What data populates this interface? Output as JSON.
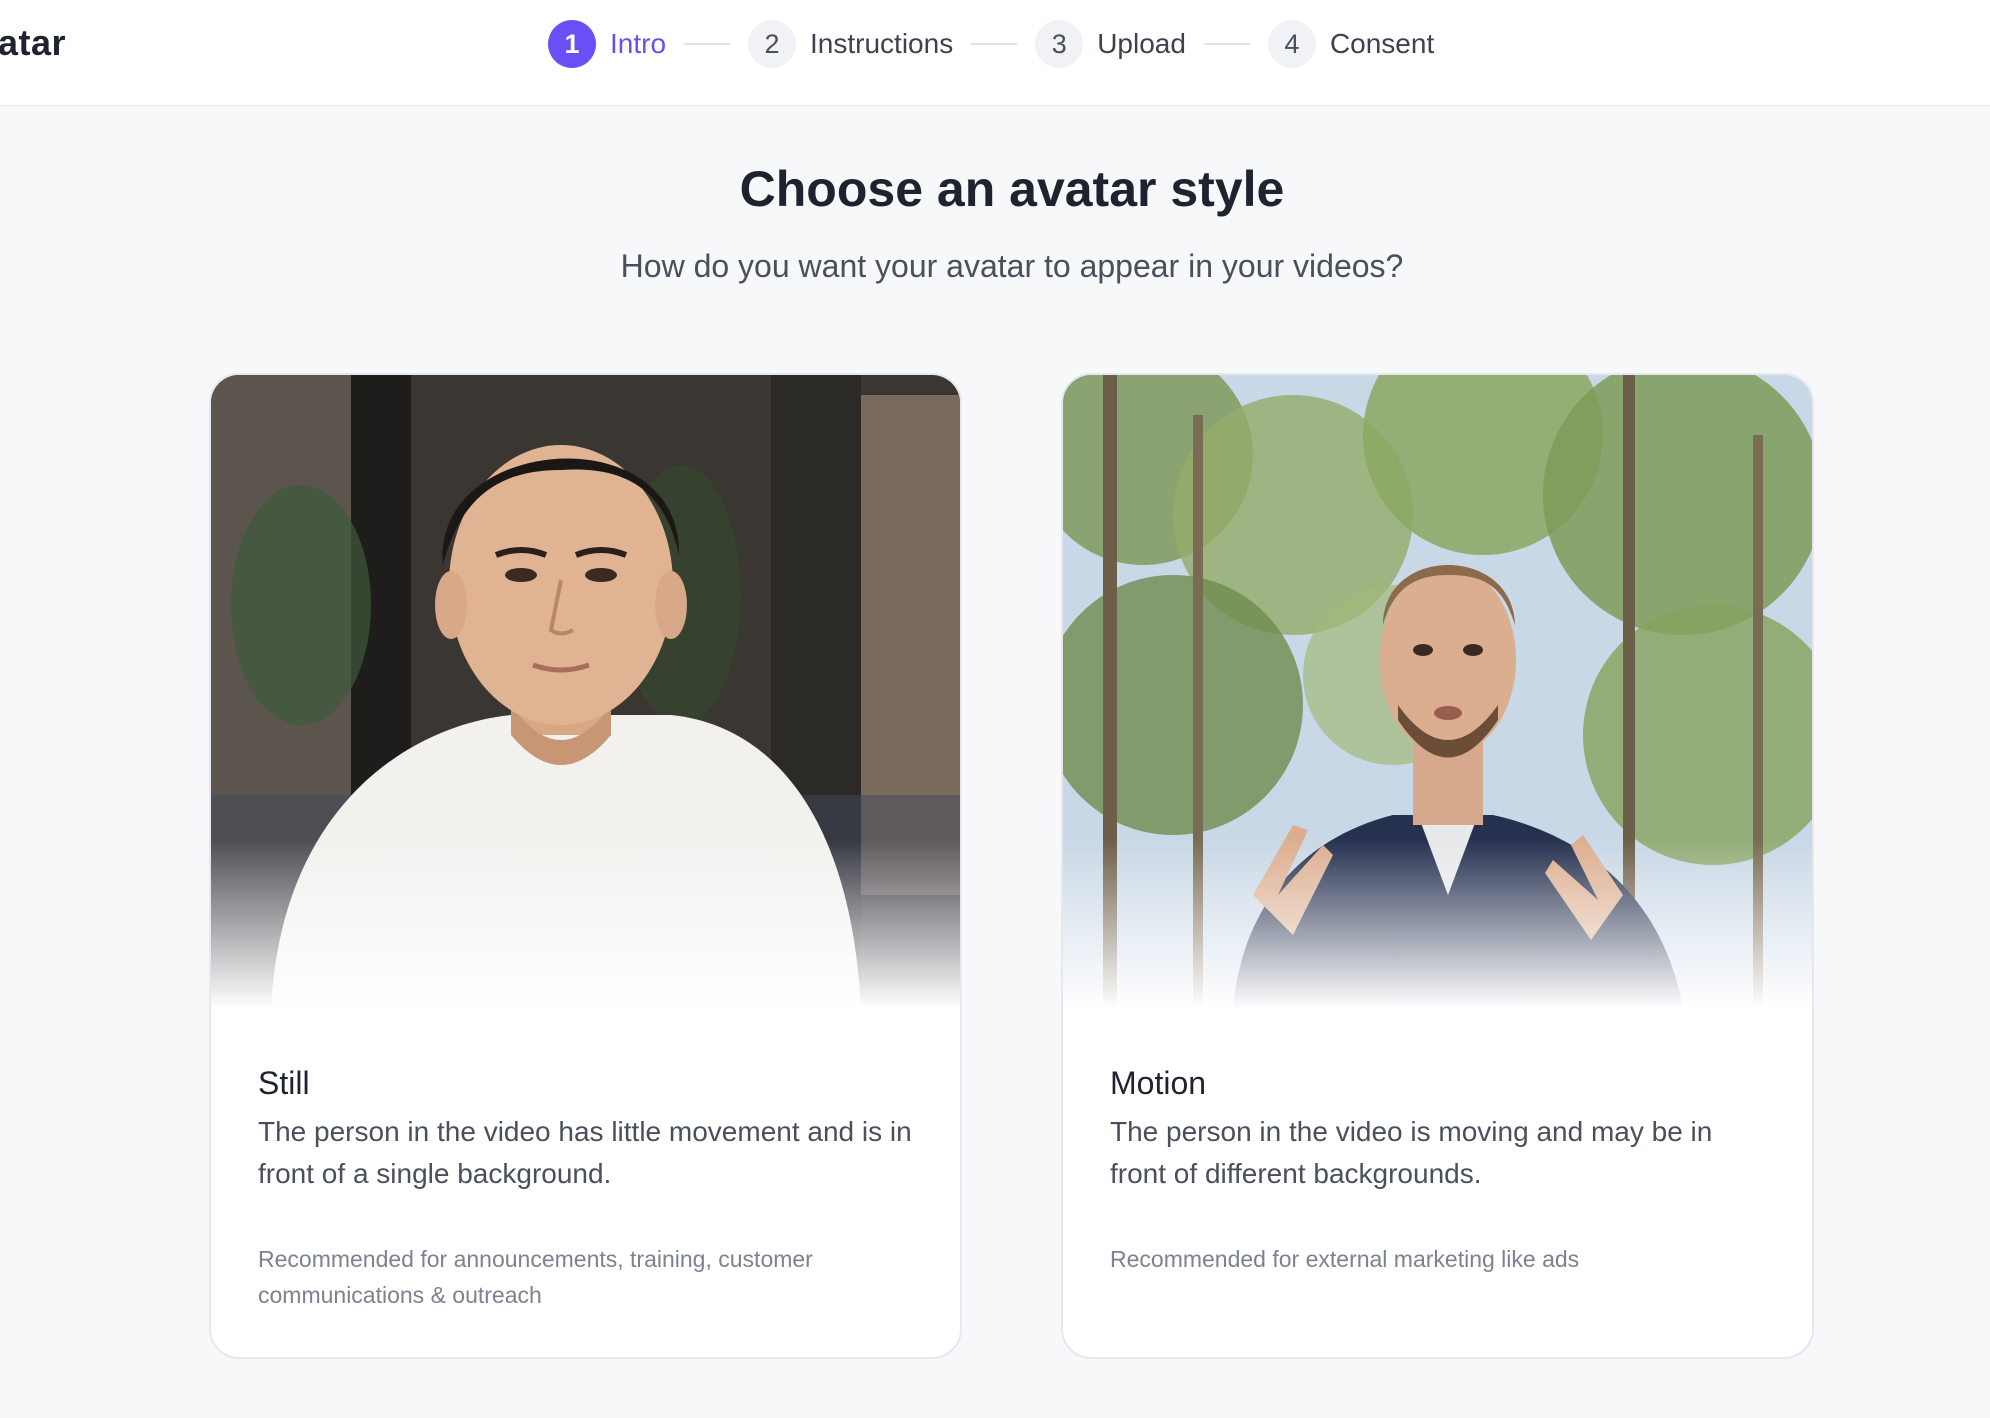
{
  "header": {
    "brand_fragment": "atar",
    "steps": [
      {
        "number": "1",
        "label": "Intro",
        "active": true
      },
      {
        "number": "2",
        "label": "Instructions",
        "active": false
      },
      {
        "number": "3",
        "label": "Upload",
        "active": false
      },
      {
        "number": "4",
        "label": "Consent",
        "active": false
      }
    ]
  },
  "main": {
    "title": "Choose an avatar style",
    "subtitle": "How do you want your avatar to appear in your videos?",
    "cards": [
      {
        "title": "Still",
        "description": "The person in the video has little movement and is in front of a single background.",
        "recommendation": "Recommended for announcements, training, customer communications & outreach"
      },
      {
        "title": "Motion",
        "description": "The person in the video is moving and may be in front of different backgrounds.",
        "recommendation": "Recommended for external marketing like ads"
      }
    ]
  },
  "colors": {
    "accent": "#6a4ff6",
    "page_background": "#f7f8fa",
    "card_background": "#ffffff"
  }
}
